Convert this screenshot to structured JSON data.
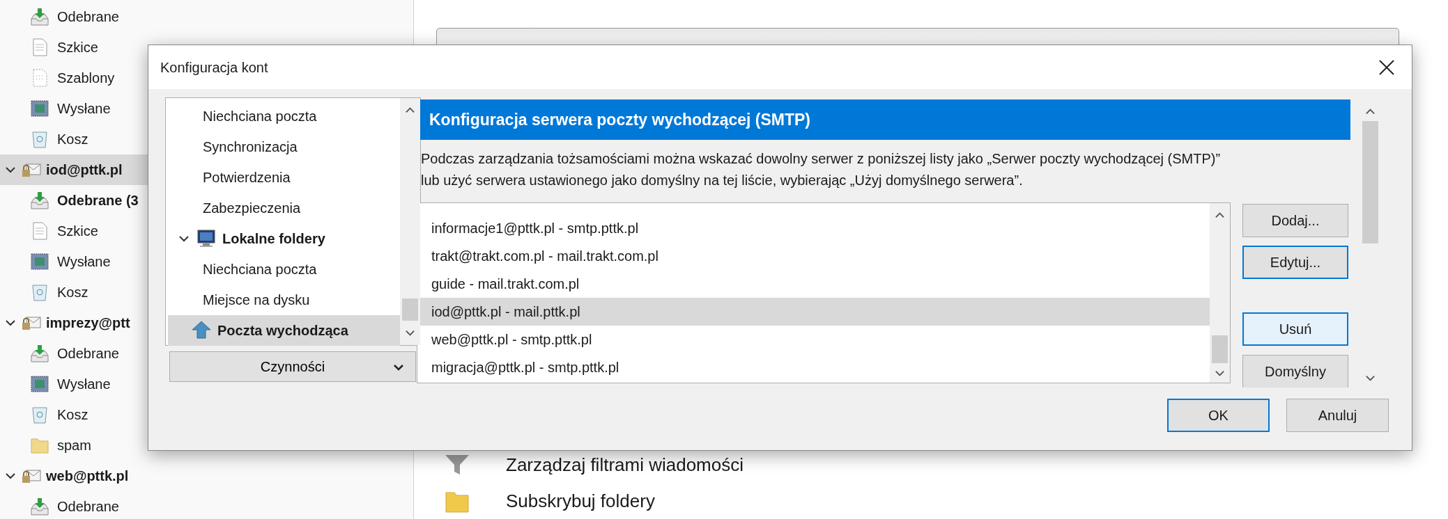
{
  "sidebar": {
    "items": [
      {
        "kind": "inbox",
        "label": "Odebrane",
        "selected": false,
        "unread": false
      },
      {
        "kind": "drafts",
        "label": "Szkice",
        "selected": false,
        "unread": false
      },
      {
        "kind": "templates",
        "label": "Szablony",
        "selected": false,
        "unread": false
      },
      {
        "kind": "sent",
        "label": "Wysłane",
        "selected": false,
        "unread": false
      },
      {
        "kind": "trash",
        "label": "Kosz",
        "selected": false,
        "unread": false
      },
      {
        "kind": "account",
        "label": "iod@pttk.pl",
        "selected": true,
        "unread": false,
        "expanded": true,
        "children": [
          {
            "kind": "inbox",
            "label": "Odebrane (3",
            "selected": false,
            "unread": true
          },
          {
            "kind": "drafts",
            "label": "Szkice",
            "selected": false,
            "unread": false
          },
          {
            "kind": "sent",
            "label": "Wysłane",
            "selected": false,
            "unread": false
          },
          {
            "kind": "trash",
            "label": "Kosz",
            "selected": false,
            "unread": false
          }
        ]
      },
      {
        "kind": "account",
        "label": "imprezy@ptt",
        "selected": false,
        "unread": false,
        "expanded": true,
        "children": [
          {
            "kind": "inbox",
            "label": "Odebrane",
            "selected": false,
            "unread": false
          },
          {
            "kind": "sent",
            "label": "Wysłane",
            "selected": false,
            "unread": false
          },
          {
            "kind": "trash",
            "label": "Kosz",
            "selected": false,
            "unread": false
          },
          {
            "kind": "folder",
            "label": "spam",
            "selected": false,
            "unread": false
          }
        ]
      },
      {
        "kind": "account",
        "label": "web@pttk.pl",
        "selected": false,
        "unread": false,
        "expanded": true,
        "children": [
          {
            "kind": "inbox",
            "label": "Odebrane",
            "selected": false,
            "unread": false
          }
        ]
      }
    ]
  },
  "main": {
    "actions": [
      {
        "kind": "filters",
        "label": "Zarządzaj filtrami wiadomości"
      },
      {
        "kind": "subscribe",
        "label": "Subskrybuj foldery"
      }
    ]
  },
  "dialog": {
    "title": "Konfiguracja kont",
    "tree": {
      "items": [
        {
          "kind": "page",
          "label": "Niechciana poczta",
          "selected": false
        },
        {
          "kind": "page",
          "label": "Synchronizacja",
          "selected": false
        },
        {
          "kind": "page",
          "label": "Potwierdzenia",
          "selected": false
        },
        {
          "kind": "page",
          "label": "Zabezpieczenia",
          "selected": false
        },
        {
          "kind": "local",
          "label": "Lokalne foldery",
          "selected": false,
          "expanded": true,
          "children": [
            {
              "kind": "page",
              "label": "Niechciana poczta",
              "selected": false
            },
            {
              "kind": "page",
              "label": "Miejsce na dysku",
              "selected": false
            }
          ]
        },
        {
          "kind": "outgoing",
          "label": "Poczta wychodząca",
          "selected": true
        }
      ]
    },
    "actions_button": {
      "label": "Czynności"
    },
    "heading": "Konfiguracja serwera poczty wychodzącej (SMTP)",
    "description_lines": [
      "Podczas zarządzania tożsamościami można wskazać dowolny serwer z poniższej listy jako „Serwer poczty wychodzącej (SMTP)”",
      "lub użyć serwera ustawionego jako domyślny na tej liście, wybierając „Użyj domyślnego serwera”."
    ],
    "servers": [
      {
        "label": "informacje1@pttk.pl - smtp.pttk.pl",
        "selected": false
      },
      {
        "label": "trakt@trakt.com.pl - mail.trakt.com.pl",
        "selected": false
      },
      {
        "label": "guide - mail.trakt.com.pl",
        "selected": false
      },
      {
        "label": "iod@pttk.pl - mail.pttk.pl",
        "selected": true
      },
      {
        "label": "web@pttk.pl - smtp.pttk.pl",
        "selected": false
      },
      {
        "label": "migracja@pttk.pl - smtp.pttk.pl",
        "selected": false
      }
    ],
    "server_buttons": [
      {
        "label": "Dodaj...",
        "focused": false,
        "hovered": false
      },
      {
        "label": "Edytuj...",
        "focused": true,
        "hovered": false
      },
      {
        "label": "Usuń",
        "focused": false,
        "hovered": true
      },
      {
        "label": "Domyślny",
        "focused": false,
        "hovered": false
      }
    ],
    "footer_buttons": [
      {
        "label": "OK",
        "focused": true,
        "hovered": false
      },
      {
        "label": "Anuluj",
        "focused": false,
        "hovered": false
      }
    ]
  }
}
